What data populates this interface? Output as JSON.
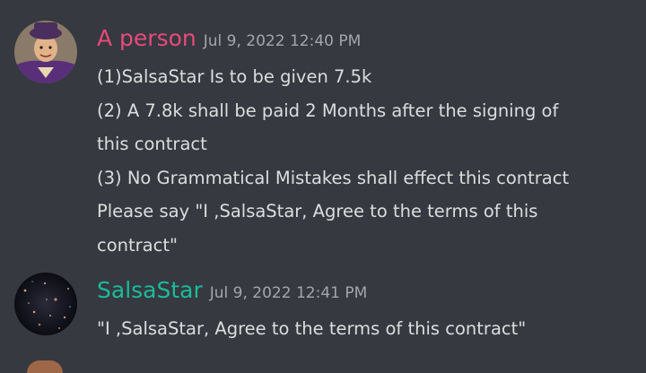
{
  "messages": [
    {
      "author": "A person",
      "author_color": "#e64a7b",
      "timestamp": "Jul 9, 2022 12:40 PM",
      "lines": [
        "(1)SalsaStar Is to be given 7.5k",
        "(2) A 7.8k shall be paid 2 Months after the signing of",
        "this contract",
        "(3) No Grammatical Mistakes shall effect this contract",
        "Please say \"I ,SalsaStar, Agree to the terms of this",
        "contract\""
      ]
    },
    {
      "author": "SalsaStar",
      "author_color": "#1abc9c",
      "timestamp": "Jul 9, 2022 12:41 PM",
      "lines": [
        "\"I ,SalsaStar, Agree to the terms of this contract\""
      ]
    }
  ]
}
